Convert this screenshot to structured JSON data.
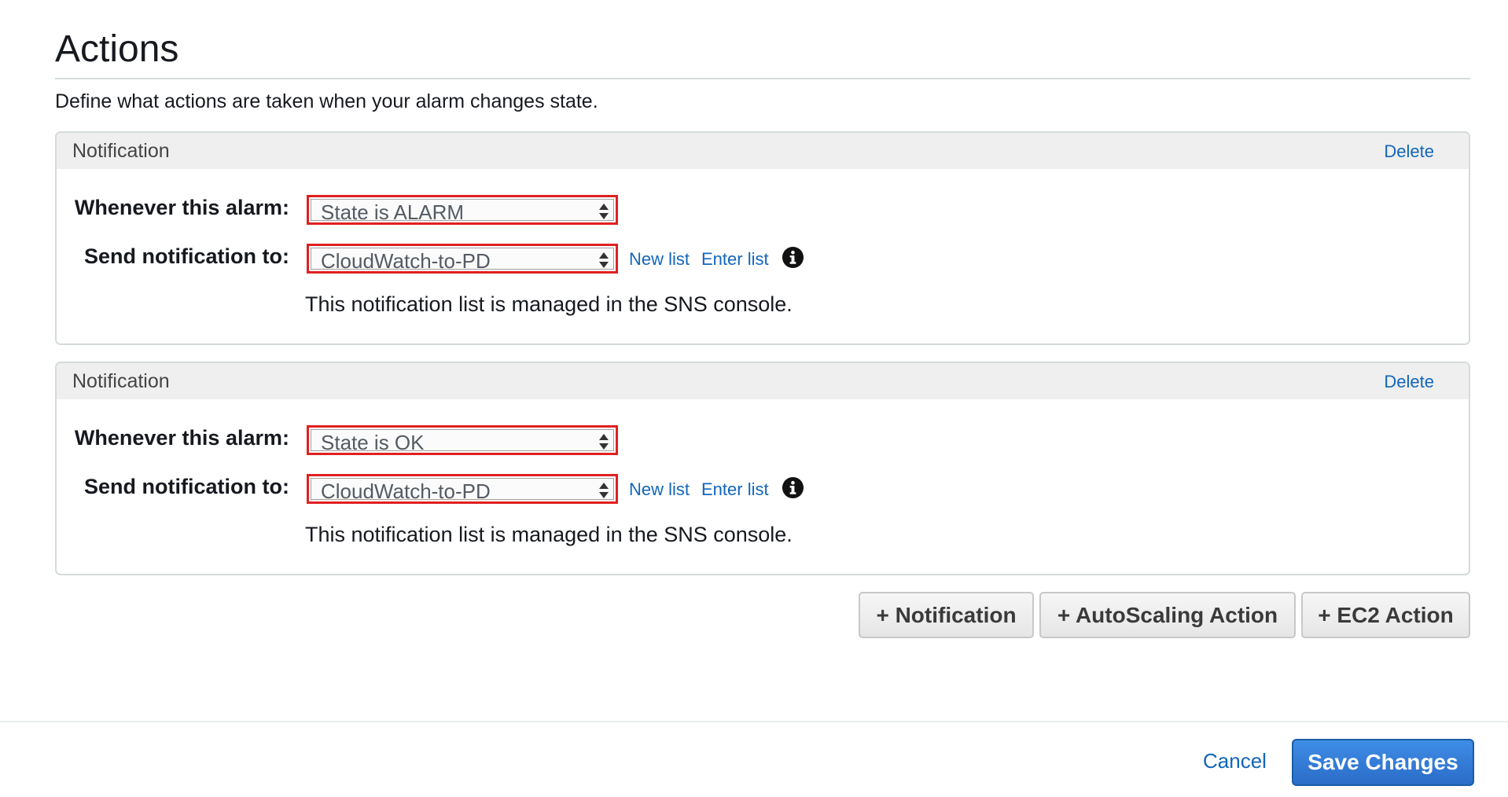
{
  "section": {
    "title": "Actions",
    "description": "Define what actions are taken when your alarm changes state."
  },
  "notifications": [
    {
      "title": "Notification",
      "delete_label": "Delete",
      "alarm_label": "Whenever this alarm:",
      "alarm_state": "State is ALARM",
      "send_label": "Send notification to:",
      "topic": "CloudWatch-to-PD",
      "new_list_label": "New list",
      "enter_list_label": "Enter list",
      "note": "This notification list is managed in the SNS console."
    },
    {
      "title": "Notification",
      "delete_label": "Delete",
      "alarm_label": "Whenever this alarm:",
      "alarm_state": "State is OK",
      "send_label": "Send notification to:",
      "topic": "CloudWatch-to-PD",
      "new_list_label": "New list",
      "enter_list_label": "Enter list",
      "note": "This notification list is managed in the SNS console."
    }
  ],
  "add_buttons": {
    "notification": "+ Notification",
    "autoscaling": "+ AutoScaling Action",
    "ec2": "+ EC2 Action"
  },
  "footer": {
    "cancel_label": "Cancel",
    "save_label": "Save Changes"
  },
  "colors": {
    "link": "#1166bb",
    "highlight_border": "#e02020",
    "primary_button": "#2a6cc7"
  },
  "icons": {
    "info": "info-circle-icon",
    "select_arrows": "up-down-arrows-icon"
  }
}
